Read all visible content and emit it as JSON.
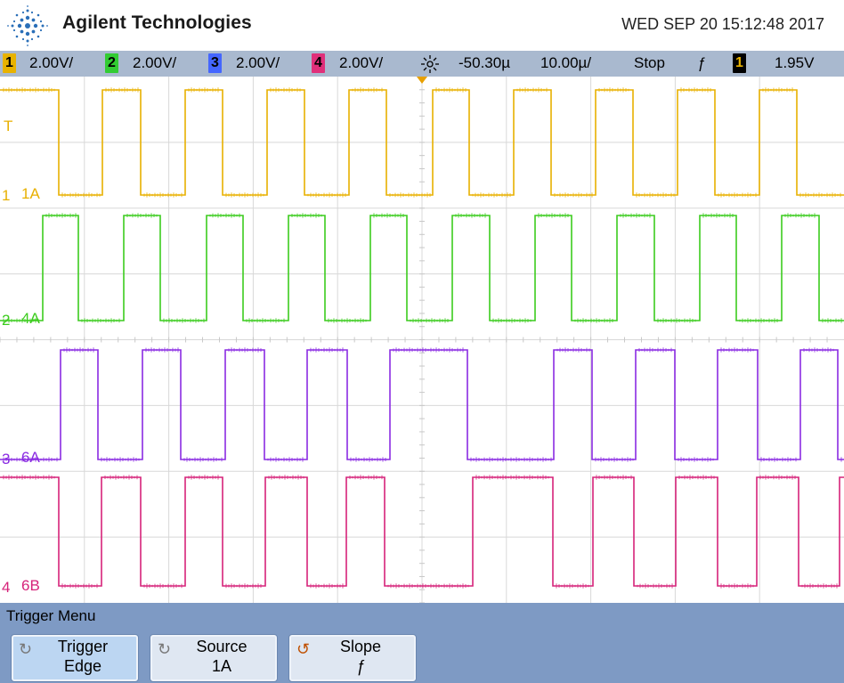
{
  "header": {
    "brand": "Agilent Technologies",
    "datetime": "WED SEP 20 15:12:48 2017"
  },
  "status": {
    "channels": [
      {
        "badge": "1",
        "scale": "2.00V/",
        "color": "#e8b200"
      },
      {
        "badge": "2",
        "scale": "2.00V/",
        "color": "#33cc33"
      },
      {
        "badge": "3",
        "scale": "2.00V/",
        "color": "#4466ff"
      },
      {
        "badge": "4",
        "scale": "2.00V/",
        "color": "#e0307a"
      }
    ],
    "delay": "-50.30µ",
    "timebase": "10.00µ/",
    "run_state": "Stop",
    "trigger_slope_symbol": "ƒ",
    "trigger_channel_badge": "1",
    "trigger_level": "1.95V"
  },
  "display": {
    "trigger_marker": "T",
    "traces": [
      {
        "marker": "1",
        "label": "1A",
        "color": "#e8b000"
      },
      {
        "marker": "2",
        "label": "4A",
        "color": "#3ccc1e"
      },
      {
        "marker": "3",
        "label": "6A",
        "color": "#8a2be2"
      },
      {
        "marker": "4",
        "label": "6B",
        "color": "#d6237a"
      }
    ]
  },
  "menu": {
    "title": "Trigger Menu",
    "softkeys": [
      {
        "line1": "Trigger",
        "line2": "Edge",
        "icon": "rotate-arrow-icon"
      },
      {
        "line1": "Source",
        "line2": "1A",
        "icon": "rotate-arrow-icon"
      },
      {
        "line1": "Slope",
        "line2": "ƒ",
        "icon": "rotate-arrow-icon"
      }
    ]
  }
}
